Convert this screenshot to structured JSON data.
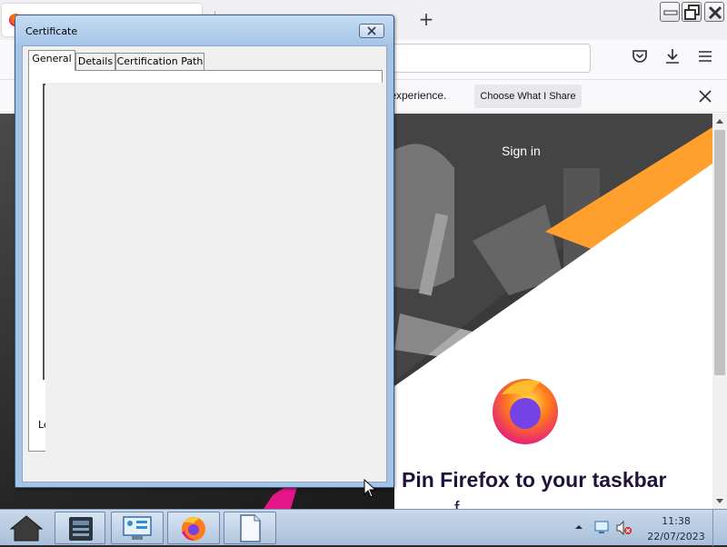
{
  "browser": {
    "new_tab_glyph": "+",
    "notification": {
      "text": "r experience.",
      "button_label": "Choose What I Share"
    },
    "page": {
      "sign_in": "Sign in",
      "heading": "Pin Firefox to your taskbar",
      "subheading": "f"
    },
    "icons": [
      "firefox-favicon",
      "pocket-icon",
      "download-icon",
      "menu-icon",
      "close-icon"
    ]
  },
  "dialog": {
    "title": "Certificate",
    "tabs": [
      {
        "label": "General",
        "selected": true
      },
      {
        "label": "Details",
        "selected": false
      },
      {
        "label": "Certification Path",
        "selected": false
      }
    ],
    "panel_letter": "Le"
  },
  "taskbar": {
    "apps": [
      "disk-manager-icon",
      "control-panel-icon",
      "firefox-icon",
      "document-icon"
    ],
    "clock": {
      "time": "11:38",
      "date": "22/07/2023"
    }
  },
  "colors": {
    "dialog_frame": "#a4c4e6",
    "firefox_orange": "#ff9f2e",
    "firefox_pink": "#e31587",
    "taskbar": "#b9cbe2"
  }
}
